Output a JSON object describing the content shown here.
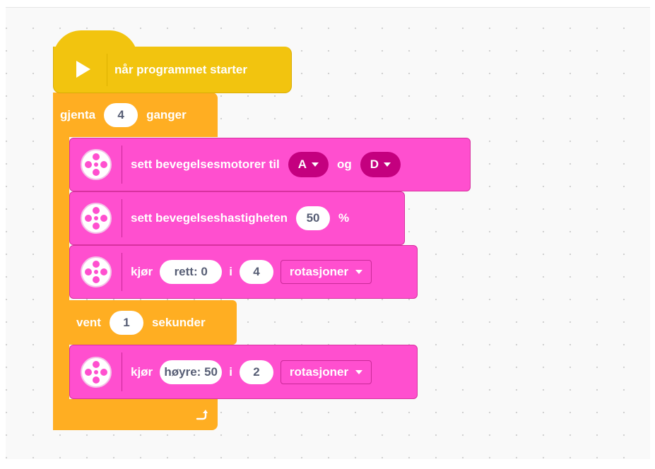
{
  "hat": {
    "label": "når programmet starter",
    "icon": "play-icon",
    "color": "#f2c40f"
  },
  "repeat": {
    "prefix": "gjenta",
    "count": "4",
    "suffix": "ganger",
    "loop_icon": "loop-arrow-icon",
    "color": "#ffae22"
  },
  "blocks": {
    "set_motors": {
      "text": "sett bevegelsesmotorer til",
      "port1": "A",
      "conj": "og",
      "port2": "D"
    },
    "set_speed": {
      "text": "sett bevegelseshastigheten",
      "value": "50",
      "unit": "%"
    },
    "drive1": {
      "verb": "kjør",
      "direction": "rett: 0",
      "prep": "i",
      "amount": "4",
      "unit": "rotasjoner"
    },
    "wait": {
      "prefix": "vent",
      "value": "1",
      "suffix": "sekunder"
    },
    "drive2": {
      "verb": "kjør",
      "direction": "høyre: 50",
      "prep": "i",
      "amount": "2",
      "unit": "rotasjoner"
    }
  },
  "colors": {
    "motor": "#ff4fcf",
    "motor_dark": "#c4007f",
    "control": "#ffae22"
  }
}
